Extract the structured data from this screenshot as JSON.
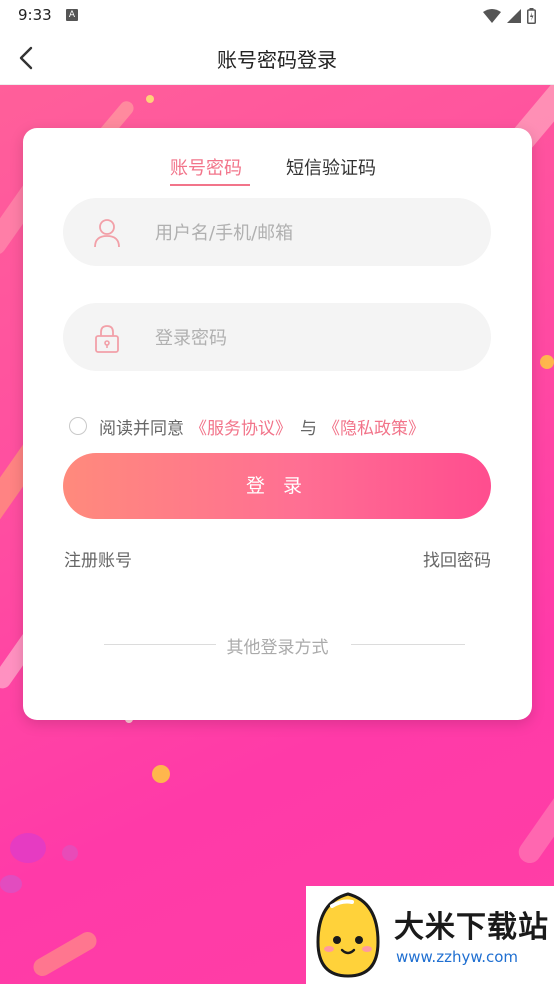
{
  "status_bar": {
    "time": "9:33",
    "badge": "A"
  },
  "nav": {
    "title": "账号密码登录"
  },
  "tabs": {
    "account": "账号密码",
    "sms": "短信验证码"
  },
  "username": {
    "placeholder": "用户名/手机/邮箱",
    "value": ""
  },
  "password": {
    "placeholder": "登录密码",
    "value": ""
  },
  "agreement": {
    "prefix": "阅读并同意",
    "service_link": "《服务协议》",
    "and": "与",
    "privacy_link": "《隐私政策》",
    "checked": false
  },
  "login_button": "登 录",
  "register": "注册账号",
  "forgot": "找回密码",
  "other_login": "其他登录方式",
  "watermark": {
    "title": "大米下载站",
    "url": "www.zzhyw.com"
  },
  "colors": {
    "accent": "#f2748a",
    "background": "#ff4fa0",
    "button_start": "#ff8a7c",
    "button_end": "#ff4d8f"
  }
}
